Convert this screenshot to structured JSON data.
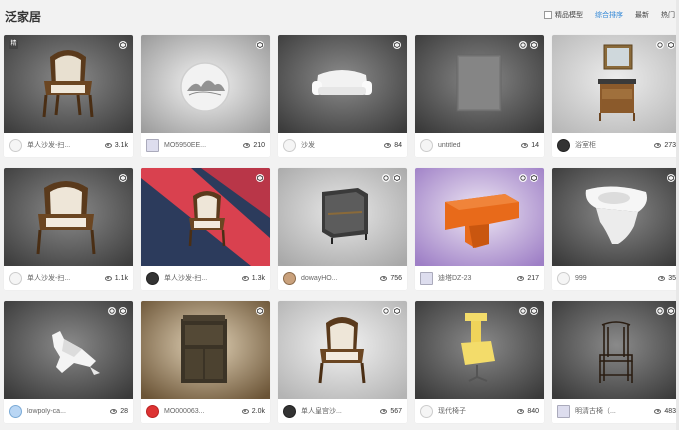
{
  "header": {
    "title": "泛家居",
    "filter_checkbox_label": "精品模型",
    "sort_labels": [
      "综合排序",
      "最新",
      "热门"
    ],
    "active_sort": "综合排序"
  },
  "cards": [
    {
      "name": "单人沙发-扫...",
      "views": "3.1k",
      "avatar": "default",
      "fine": true,
      "vr": false
    },
    {
      "name": "MO5950EE...",
      "views": "210",
      "avatar": "img",
      "fine": false,
      "vr": false
    },
    {
      "name": "沙发",
      "views": "84",
      "avatar": "default",
      "fine": false,
      "vr": false
    },
    {
      "name": "untitled",
      "views": "14",
      "avatar": "default",
      "fine": false,
      "vr": true
    },
    {
      "name": "浴室柜",
      "views": "273",
      "avatar": "dark",
      "fine": false,
      "vr": true
    },
    {
      "name": "单人沙发-扫...",
      "views": "1.1k",
      "avatar": "default",
      "fine": false,
      "vr": false
    },
    {
      "name": "单人沙发-扫...",
      "views": "1.3k",
      "avatar": "dark",
      "fine": false,
      "vr": false
    },
    {
      "name": "dowayHO...",
      "views": "756",
      "avatar": "person",
      "fine": false,
      "vr": true
    },
    {
      "name": "迪塔DZ-23",
      "views": "217",
      "avatar": "img",
      "fine": false,
      "vr": true
    },
    {
      "name": "999",
      "views": "35",
      "avatar": "default",
      "fine": false,
      "vr": false
    },
    {
      "name": "lowpoly-ca...",
      "views": "28",
      "avatar": "blue",
      "fine": false,
      "vr": true
    },
    {
      "name": "MO000063...",
      "views": "2.0k",
      "avatar": "red",
      "fine": false,
      "vr": false
    },
    {
      "name": "单人皇宫沙...",
      "views": "567",
      "avatar": "dark",
      "fine": false,
      "vr": true
    },
    {
      "name": "现代椅子",
      "views": "840",
      "avatar": "default",
      "fine": false,
      "vr": true
    },
    {
      "name": "明清古椅（...",
      "views": "483",
      "avatar": "img",
      "fine": false,
      "vr": true
    }
  ],
  "colors": {
    "accent": "#2f86d6",
    "background": "#f2f2f2"
  }
}
